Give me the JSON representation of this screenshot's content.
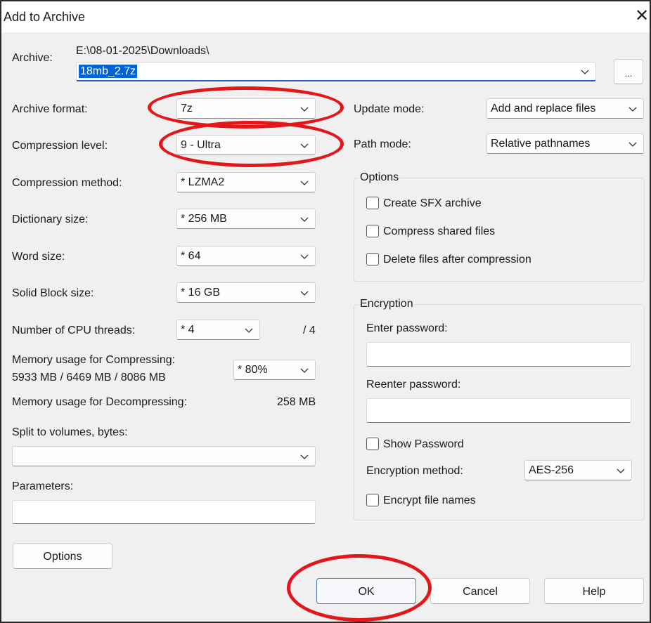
{
  "window": {
    "title": "Add to Archive"
  },
  "archive": {
    "label": "Archive:",
    "path": "E:\\08-01-2025\\Downloads\\",
    "filename": "18mb_2.7z",
    "browse_label": "..."
  },
  "left": {
    "archive_format": {
      "label": "Archive format:",
      "value": "7z"
    },
    "compression_level": {
      "label": "Compression level:",
      "value": "9 - Ultra"
    },
    "compression_method": {
      "label": "Compression method:",
      "value": "*  LZMA2"
    },
    "dictionary_size": {
      "label": "Dictionary size:",
      "value": "*  256 MB"
    },
    "word_size": {
      "label": "Word size:",
      "value": "*  64"
    },
    "solid_block_size": {
      "label": "Solid Block size:",
      "value": "*  16 GB"
    },
    "cpu_threads": {
      "label": "Number of CPU threads:",
      "value": "*  4",
      "max": "/ 4"
    },
    "memory_compress": {
      "label": "Memory usage for Compressing:",
      "detail": "5933 MB / 6469 MB / 8086 MB",
      "value": "*  80%"
    },
    "memory_decompress": {
      "label": "Memory usage for Decompressing:",
      "value": "258 MB"
    },
    "split_volumes": {
      "label": "Split to volumes, bytes:",
      "value": ""
    },
    "parameters": {
      "label": "Parameters:",
      "value": ""
    },
    "options_button": "Options"
  },
  "right": {
    "update_mode": {
      "label": "Update mode:",
      "value": "Add and replace files"
    },
    "path_mode": {
      "label": "Path mode:",
      "value": "Relative pathnames"
    },
    "options_group": {
      "title": "Options",
      "create_sfx": "Create SFX archive",
      "compress_shared": "Compress shared files",
      "delete_after": "Delete files after compression"
    },
    "encryption_group": {
      "title": "Encryption",
      "enter_password": "Enter password:",
      "reenter_password": "Reenter password:",
      "show_password": "Show Password",
      "method_label": "Encryption method:",
      "method_value": "AES-256",
      "encrypt_names": "Encrypt file names"
    }
  },
  "buttons": {
    "ok": "OK",
    "cancel": "Cancel",
    "help": "Help"
  },
  "colors": {
    "annotation": "#e3161a",
    "selection": "#0063d6",
    "focus": "#2c62c7"
  }
}
